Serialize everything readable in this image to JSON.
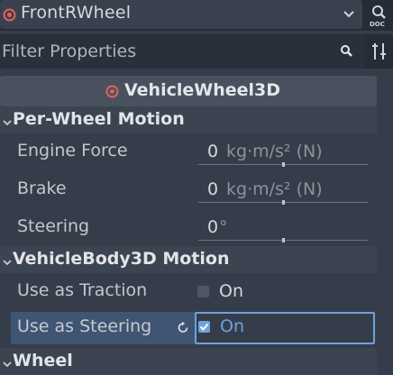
{
  "node_bar": {
    "node_name": "FrontRWheel",
    "node_icon": "wheel-target-icon",
    "dropdown_icon": "chevron-down-icon",
    "doc_icon": "doc-search-icon"
  },
  "filter": {
    "placeholder": "Filter Properties",
    "search_icon": "search-icon",
    "tools_icon": "property-tools-icon"
  },
  "class_header": {
    "title": "VehicleWheel3D",
    "icon": "wheel-target-icon"
  },
  "sections": {
    "per_wheel_motion": {
      "title": "Per-Wheel Motion",
      "properties": {
        "engine_force": {
          "label": "Engine Force",
          "value": "0",
          "unit": "kg·m/s² (N)"
        },
        "brake": {
          "label": "Brake",
          "value": "0",
          "unit": "kg·m/s² (N)"
        },
        "steering": {
          "label": "Steering",
          "value": "0",
          "unit": "°"
        }
      }
    },
    "vehiclebody_motion": {
      "title": "VehicleBody3D Motion",
      "properties": {
        "use_as_traction": {
          "label": "Use as Traction",
          "checked": false,
          "text": "On"
        },
        "use_as_steering": {
          "label": "Use as Steering",
          "checked": true,
          "text": "On"
        }
      }
    },
    "wheel": {
      "title": "Wheel"
    }
  },
  "colors": {
    "background": "#363d4a",
    "accent": "#6ea2df",
    "wheel_icon": "#e0615c",
    "selected_row": "#3f5573"
  }
}
